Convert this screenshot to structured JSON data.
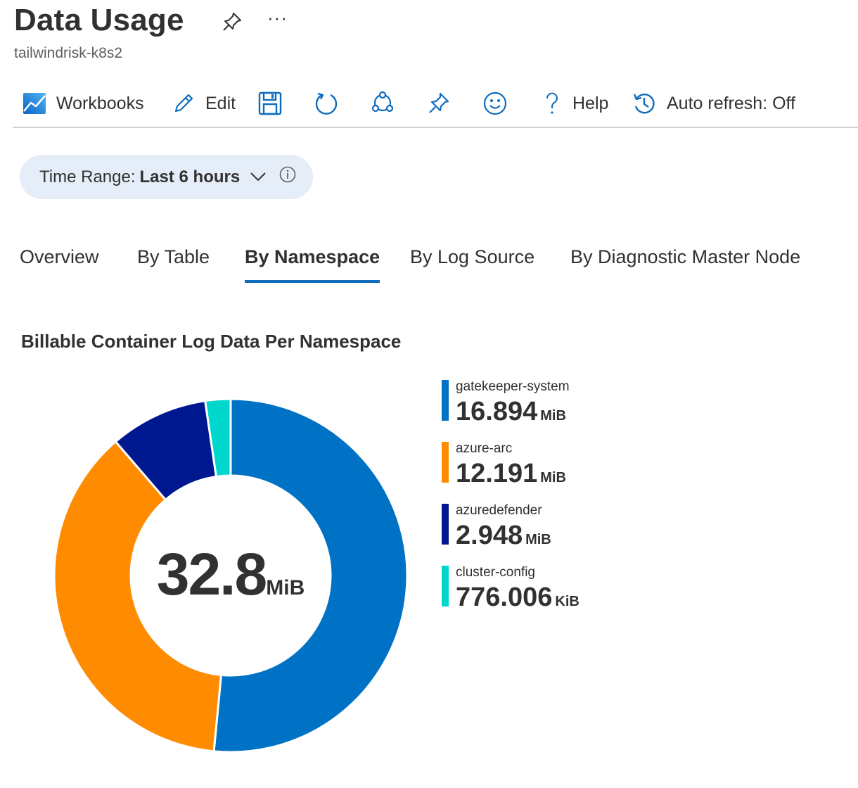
{
  "header": {
    "title": "Data Usage",
    "more": "···",
    "subtitle": "tailwindrisk-k8s2"
  },
  "toolbar": {
    "workbooks_label": "Workbooks",
    "edit_label": "Edit",
    "help_label": "Help",
    "auto_refresh_label": "Auto refresh: Off"
  },
  "time_range": {
    "label": "Time Range:",
    "value": "Last 6 hours"
  },
  "tabs": [
    {
      "label": "Overview",
      "active": false
    },
    {
      "label": "By Table",
      "active": false
    },
    {
      "label": "By Namespace",
      "active": true
    },
    {
      "label": "By Log Source",
      "active": false
    },
    {
      "label": "By Diagnostic Master Node",
      "active": false
    }
  ],
  "colors": {
    "accent": "#0f6cbd",
    "pill_bg": "#e5eef8"
  },
  "chart_data": {
    "type": "pie",
    "title": "Billable Container Log Data Per Namespace",
    "center_value": "32.8",
    "center_unit": "MiB",
    "legend_position": "right",
    "series": [
      {
        "name": "gatekeeper-system",
        "value_text": "16.894",
        "unit": "MiB",
        "value_mib": 16.894,
        "color": "#0072c6"
      },
      {
        "name": "azure-arc",
        "value_text": "12.191",
        "unit": "MiB",
        "value_mib": 12.191,
        "color": "#ff8c00"
      },
      {
        "name": "azuredefender",
        "value_text": "2.948",
        "unit": "MiB",
        "value_mib": 2.948,
        "color": "#00188f"
      },
      {
        "name": "cluster-config",
        "value_text": "776.006",
        "unit": "KiB",
        "value_mib": 0.758,
        "color": "#00d7cc"
      }
    ]
  }
}
